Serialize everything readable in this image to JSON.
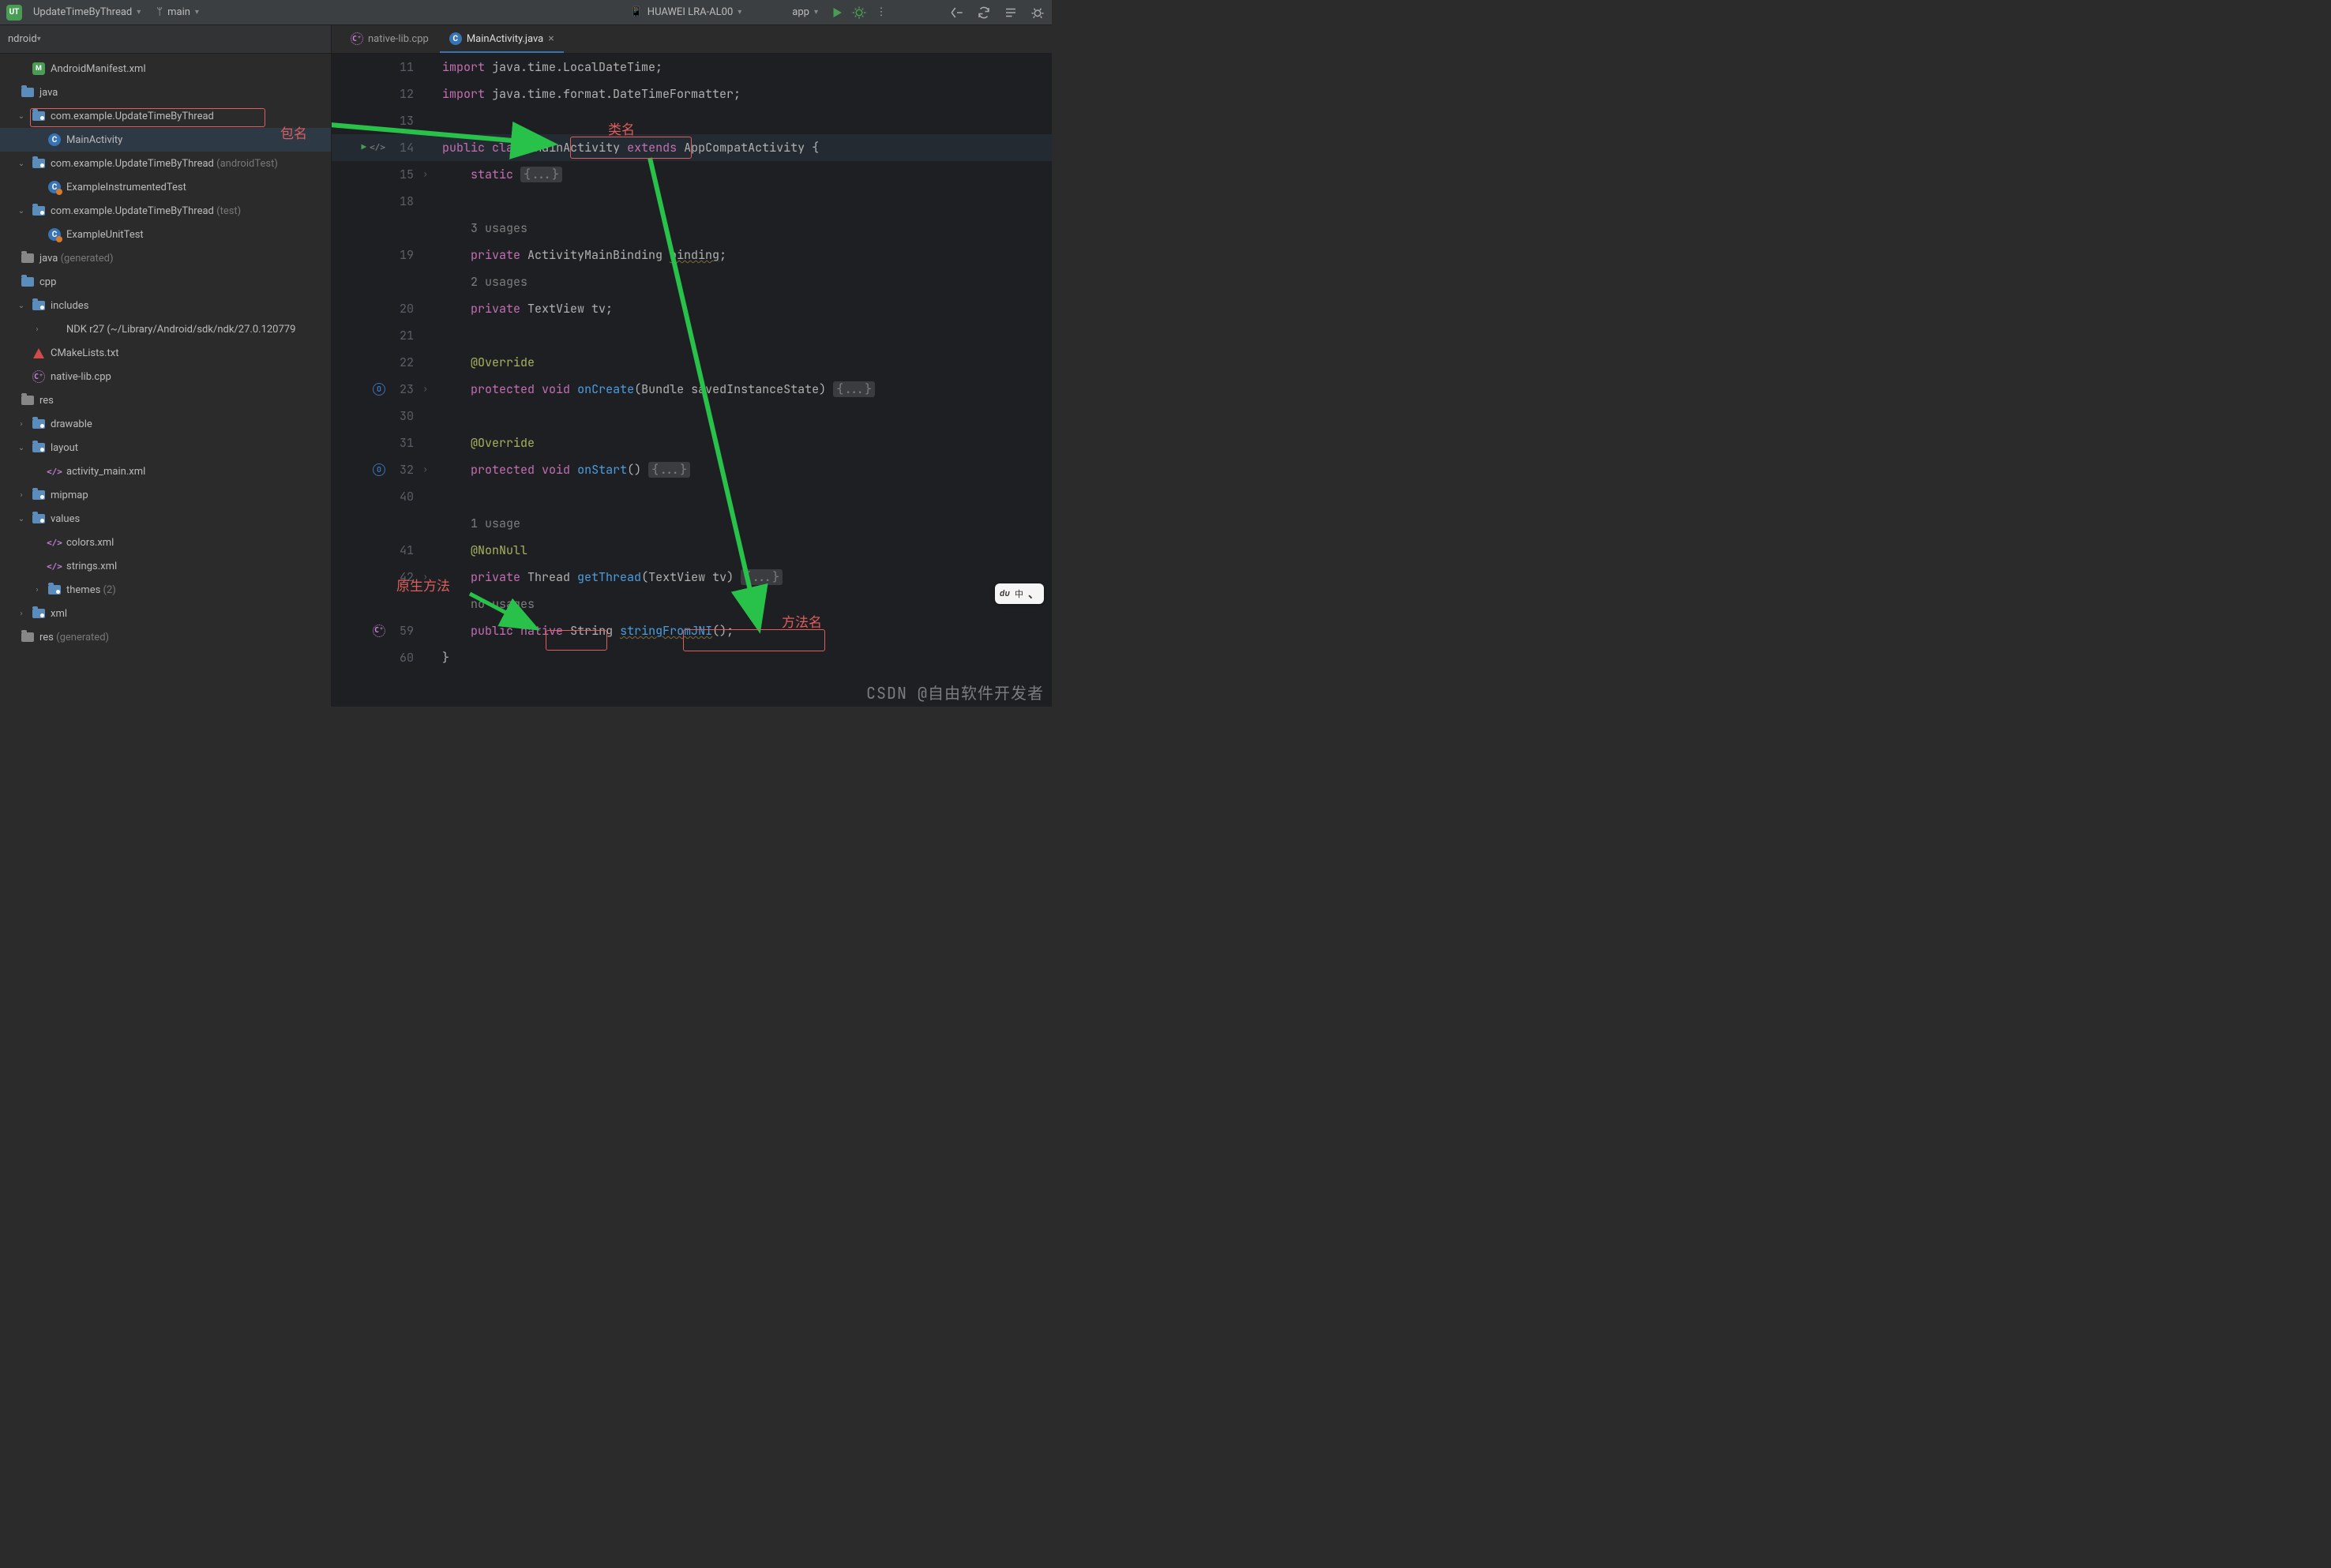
{
  "topbar": {
    "project_badge": "UT",
    "project_name": "UpdateTimeByThread",
    "branch": "main",
    "device": "HUAWEI LRA-AL00",
    "run_config": "app"
  },
  "sidebar": {
    "view_label": "ndroid",
    "items": [
      {
        "indent": 1,
        "icon": "manifest",
        "label": "AndroidManifest.xml",
        "arrow": ""
      },
      {
        "indent": 0,
        "icon": "folder",
        "label": "java",
        "arrow": ""
      },
      {
        "indent": 1,
        "icon": "package",
        "label": "com.example.UpdateTimeByThread",
        "arrow": "v",
        "boxed": true
      },
      {
        "indent": 2,
        "icon": "java-class",
        "label": "MainActivity",
        "arrow": "",
        "selected": true
      },
      {
        "indent": 1,
        "icon": "package",
        "label": "com.example.UpdateTimeByThread",
        "suffix": "(androidTest)",
        "arrow": "v"
      },
      {
        "indent": 2,
        "icon": "java-test",
        "label": "ExampleInstrumentedTest",
        "arrow": ""
      },
      {
        "indent": 1,
        "icon": "package",
        "label": "com.example.UpdateTimeByThread",
        "suffix": "(test)",
        "arrow": "v"
      },
      {
        "indent": 2,
        "icon": "java-test",
        "label": "ExampleUnitTest",
        "arrow": ""
      },
      {
        "indent": 0,
        "icon": "folder-gen",
        "label": "java",
        "suffix": "(generated)",
        "arrow": ""
      },
      {
        "indent": 0,
        "icon": "folder",
        "label": "cpp",
        "arrow": ""
      },
      {
        "indent": 1,
        "icon": "package",
        "label": "includes",
        "arrow": "v"
      },
      {
        "indent": 2,
        "icon": "none",
        "label": "NDK r27 (~/Library/Android/sdk/ndk/27.0.120779",
        "arrow": ">"
      },
      {
        "indent": 1,
        "icon": "cmake",
        "label": "CMakeLists.txt",
        "arrow": ""
      },
      {
        "indent": 1,
        "icon": "cpp",
        "label": "native-lib.cpp",
        "arrow": ""
      },
      {
        "indent": 0,
        "icon": "folder-res",
        "label": "res",
        "arrow": ""
      },
      {
        "indent": 1,
        "icon": "package",
        "label": "drawable",
        "arrow": ">"
      },
      {
        "indent": 1,
        "icon": "package",
        "label": "layout",
        "arrow": "v"
      },
      {
        "indent": 2,
        "icon": "xml",
        "label": "activity_main.xml",
        "arrow": ""
      },
      {
        "indent": 1,
        "icon": "package",
        "label": "mipmap",
        "arrow": ">"
      },
      {
        "indent": 1,
        "icon": "package",
        "label": "values",
        "arrow": "v"
      },
      {
        "indent": 2,
        "icon": "xml",
        "label": "colors.xml",
        "arrow": ""
      },
      {
        "indent": 2,
        "icon": "xml",
        "label": "strings.xml",
        "arrow": ""
      },
      {
        "indent": 2,
        "icon": "package",
        "label": "themes",
        "suffix": "(2)",
        "arrow": ">"
      },
      {
        "indent": 1,
        "icon": "package",
        "label": "xml",
        "arrow": ">"
      },
      {
        "indent": 0,
        "icon": "folder-gen",
        "label": "res",
        "suffix": "(generated)",
        "arrow": ""
      }
    ]
  },
  "tabs": [
    {
      "icon": "cpp",
      "label": "native-lib.cpp",
      "active": false,
      "closable": false
    },
    {
      "icon": "java-class",
      "label": "MainActivity.java",
      "active": true,
      "closable": true
    }
  ],
  "code": {
    "rows": [
      {
        "n": "11",
        "html": "<span class='kw'>import</span> java.time.LocalDateTime;"
      },
      {
        "n": "12",
        "html": "<span class='kw'>import</span> java.time.format.DateTimeFormatter;"
      },
      {
        "n": "13",
        "html": "",
        "hint_only": true
      },
      {
        "n": "14",
        "html": "<span class='kw'>public</span> <span class='kw'>class</span> <span class='cls'>MainActivity</span> <span class='kw'>extends</span> AppCompatActivity {",
        "run_gutter": true,
        "hl": true
      },
      {
        "n": "15",
        "html": "    <span class='kw'>static</span> <span class='fold-box'>{...}</span>",
        "fold": true
      },
      {
        "n": "18",
        "html": ""
      },
      {
        "n": "",
        "html": "    <span class='hint'>3 usages</span>"
      },
      {
        "n": "19",
        "html": "    <span class='kw'>private</span> ActivityMainBinding <span class='underline'>binding</span>;"
      },
      {
        "n": "",
        "html": "    <span class='hint'>2 usages</span>"
      },
      {
        "n": "20",
        "html": "    <span class='kw'>private</span> TextView tv;"
      },
      {
        "n": "21",
        "html": ""
      },
      {
        "n": "22",
        "html": "    <span class='ann'>@Override</span>"
      },
      {
        "n": "23",
        "html": "    <span class='kw'>protected</span> <span class='kw'>void</span> <span class='fn'>onCreate</span>(Bundle savedInstanceState) <span class='fold-box'>{...}</span>",
        "override": true,
        "fold": true
      },
      {
        "n": "30",
        "html": ""
      },
      {
        "n": "31",
        "html": "    <span class='ann'>@Override</span>"
      },
      {
        "n": "32",
        "html": "    <span class='kw'>protected</span> <span class='kw'>void</span> <span class='fn'>onStart</span>() <span class='fold-box'>{...}</span>",
        "override": true,
        "fold": true
      },
      {
        "n": "40",
        "html": ""
      },
      {
        "n": "",
        "html": "    <span class='hint'>1 usage</span>"
      },
      {
        "n": "41",
        "html": "    <span class='ann'>@NonNull</span>"
      },
      {
        "n": "42",
        "html": "    <span class='kw'>private</span> Thread <span class='fn'>getThread</span>(Te<span style='position:relative'>x</span>tView tv) <span class='fold-box'>{...}</span>",
        "fold": true
      },
      {
        "n": "",
        "html": "    <span class='hint'>no usages</span>"
      },
      {
        "n": "59",
        "html": "    <span class='kw'>public</span> <span class='kw'>native</span> String <span class='fn underline2'>stringFromJNI</span>();",
        "cpp_gutter": true
      },
      {
        "n": "60",
        "html": "}"
      }
    ]
  },
  "annotations": {
    "pkg": "包名",
    "cls": "类名",
    "native_method": "原生方法",
    "method": "方法名"
  },
  "float_toolbar": {
    "label": "中"
  },
  "watermark": "CSDN @自由软件开发者"
}
